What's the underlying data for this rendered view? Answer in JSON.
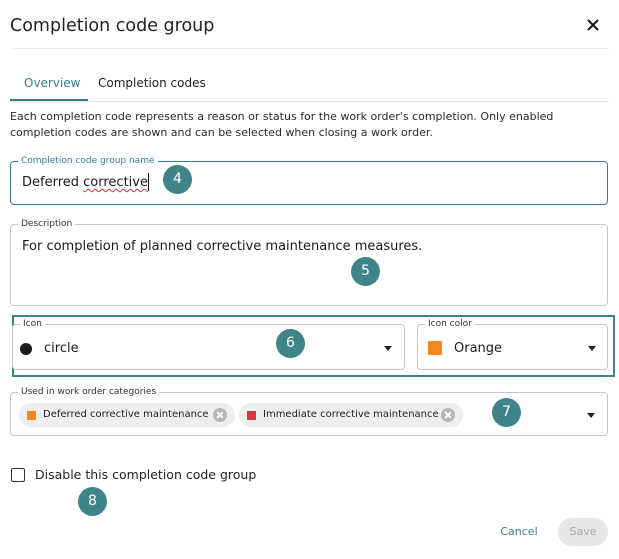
{
  "dialog": {
    "title": "Completion code group",
    "close_icon": "close-icon"
  },
  "tabs": [
    {
      "label": "Overview",
      "active": true
    },
    {
      "label": "Completion codes",
      "active": false
    }
  ],
  "info_text": "Each completion code represents a reason or status for the work order's completion. Only enabled completion codes are shown and can be selected when closing a work order.",
  "fields": {
    "name": {
      "label": "Completion code group name",
      "value_word1": "Deferred",
      "value_word2": "corrective"
    },
    "description": {
      "label": "Description",
      "value": "For completion of planned corrective maintenance measures."
    },
    "icon": {
      "label": "Icon",
      "value": "circle"
    },
    "icon_color": {
      "label": "Icon color",
      "value": "Orange",
      "swatch": "#f7861b"
    },
    "categories": {
      "label": "Used in work order categories",
      "chips": [
        {
          "label": "Deferred corrective maintenance",
          "color": "#f7861b"
        },
        {
          "label": "Immediate corrective maintenance",
          "color": "#d9363e"
        }
      ]
    }
  },
  "disable_checkbox": {
    "label": "Disable this completion code group",
    "checked": false
  },
  "actions": {
    "cancel_label": "Cancel",
    "save_label": "Save"
  },
  "markers": [
    "4",
    "5",
    "6",
    "7",
    "8"
  ],
  "colors": {
    "accent": "#3a7f8c",
    "marker": "#3f8489"
  }
}
